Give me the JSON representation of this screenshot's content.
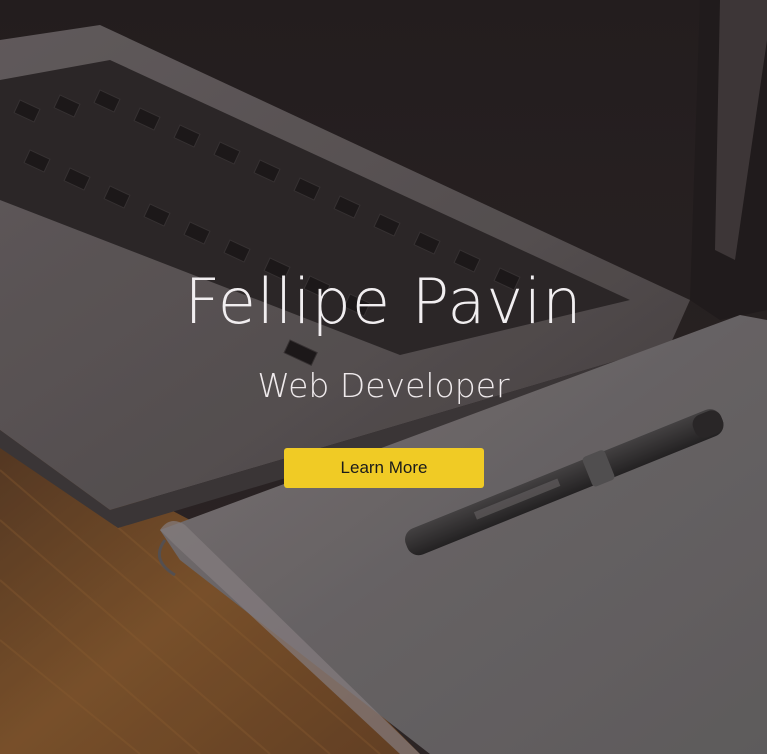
{
  "hero": {
    "name": "Fellipe Pavin",
    "role": "Web Developer",
    "cta_label": "Learn More",
    "accent_color": "#f0cb25"
  }
}
